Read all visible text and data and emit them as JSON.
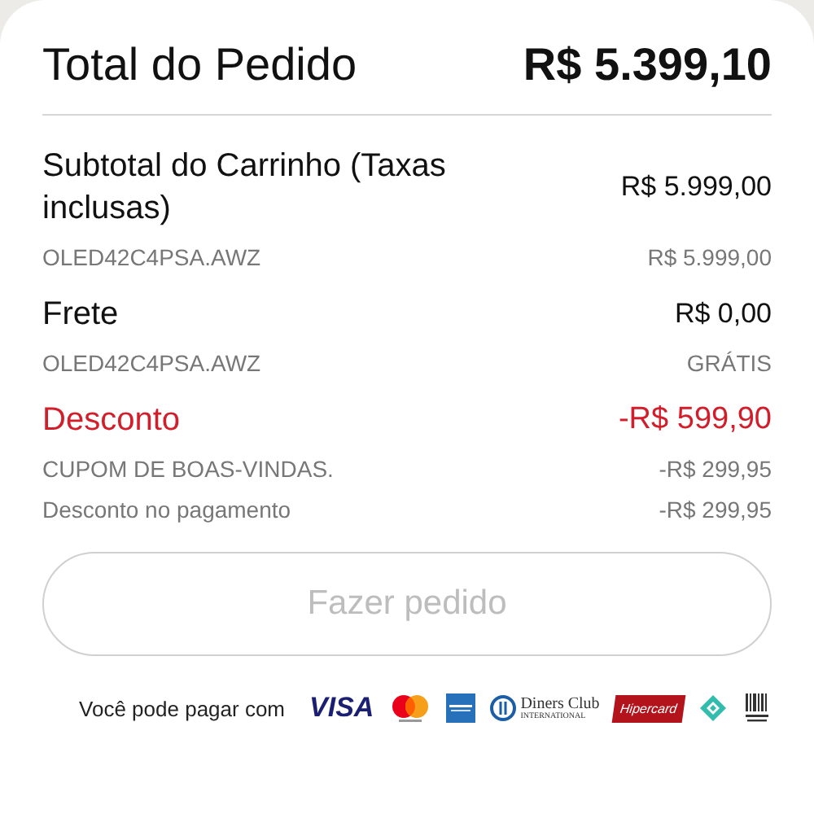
{
  "total": {
    "label": "Total do Pedido",
    "amount": "R$ 5.399,10"
  },
  "sections": [
    {
      "kind": "normal",
      "label": "Subtotal do Carrinho (Taxas inclusas)",
      "amount": "R$ 5.999,00",
      "lines": [
        {
          "label": "OLED42C4PSA.AWZ",
          "value": "R$ 5.999,00"
        }
      ]
    },
    {
      "kind": "normal",
      "label": "Frete",
      "amount": "R$ 0,00",
      "lines": [
        {
          "label": "OLED42C4PSA.AWZ",
          "value": "GRÁTIS"
        }
      ]
    },
    {
      "kind": "discount",
      "label": "Desconto",
      "amount": "-R$ 599,90",
      "lines": [
        {
          "label": "CUPOM DE BOAS-VINDAS.",
          "value": "-R$ 299,95"
        },
        {
          "label": "Desconto no pagamento",
          "value": "-R$ 299,95"
        }
      ]
    }
  ],
  "order_button": {
    "label": "Fazer pedido",
    "disabled": true
  },
  "payment": {
    "label": "Você pode pagar com",
    "methods": [
      {
        "kind": "visa",
        "text": "VISA"
      },
      {
        "kind": "mastercard"
      },
      {
        "kind": "amex"
      },
      {
        "kind": "diners",
        "text": "Diners Club",
        "subtext": "INTERNATIONAL"
      },
      {
        "kind": "hipercard",
        "text": "Hipercard"
      },
      {
        "kind": "pix"
      },
      {
        "kind": "boleto"
      }
    ]
  }
}
